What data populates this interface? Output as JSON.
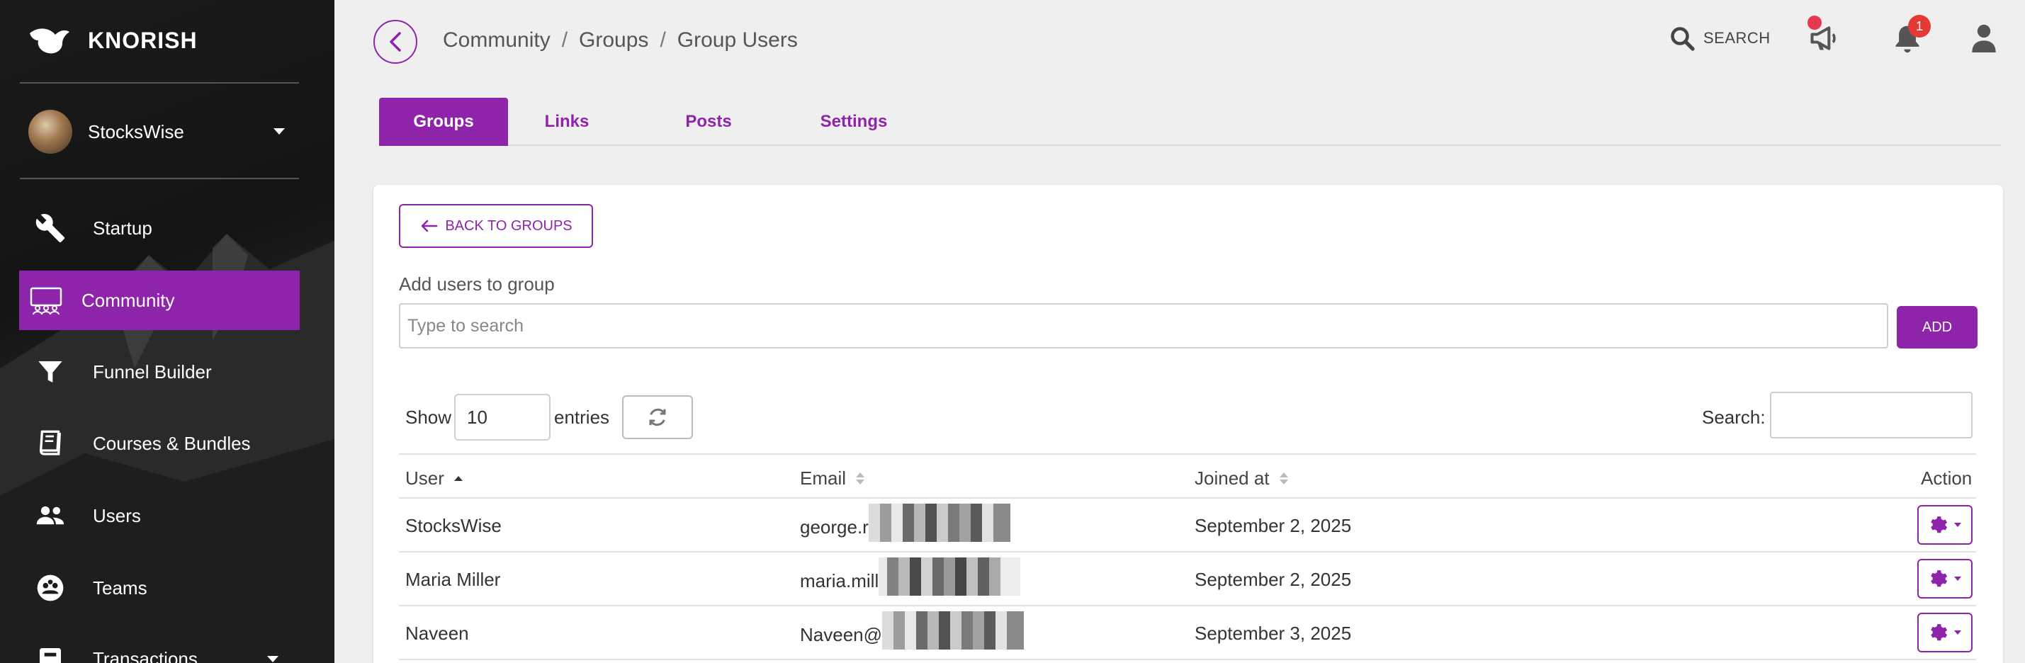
{
  "app": {
    "name": "KNORISH"
  },
  "profile": {
    "name": "StocksWise"
  },
  "sidebar": {
    "items": [
      {
        "label": "Startup",
        "icon": "wrench-icon"
      },
      {
        "label": "Community",
        "icon": "community-icon",
        "active": true
      },
      {
        "label": "Funnel Builder",
        "icon": "funnel-icon"
      },
      {
        "label": "Courses & Bundles",
        "icon": "book-icon"
      },
      {
        "label": "Users",
        "icon": "users-icon"
      },
      {
        "label": "Teams",
        "icon": "teams-icon"
      },
      {
        "label": "Transactions",
        "icon": "transactions-icon"
      }
    ]
  },
  "breadcrumb": {
    "items": [
      "Community",
      "Groups",
      "Group Users"
    ],
    "separator": "/"
  },
  "header": {
    "search_label": "SEARCH",
    "notification_count": "1"
  },
  "tabs": [
    {
      "label": "Groups",
      "active": true
    },
    {
      "label": "Links"
    },
    {
      "label": "Posts"
    },
    {
      "label": "Settings"
    }
  ],
  "card": {
    "back_label": "BACK TO GROUPS",
    "add_users_label": "Add users to group",
    "search_placeholder": "Type to search",
    "add_button": "ADD"
  },
  "table_controls": {
    "show_label": "Show",
    "entries_value": "10",
    "entries_label": "entries",
    "search_label": "Search:"
  },
  "table": {
    "columns": [
      "User",
      "Email",
      "Joined at",
      "Action"
    ],
    "rows": [
      {
        "user": "StocksWise",
        "email_visible": "george.r",
        "joined": "September 2, 2025"
      },
      {
        "user": "Maria Miller",
        "email_visible": "maria.mill",
        "joined": "September 2, 2025"
      },
      {
        "user": "Naveen",
        "email_visible": "Naveen@",
        "joined": "September 3, 2025"
      }
    ]
  },
  "colors": {
    "accent": "#8e24aa",
    "badge": "#e53935",
    "sidebar_bg": "#1b1b1b"
  }
}
